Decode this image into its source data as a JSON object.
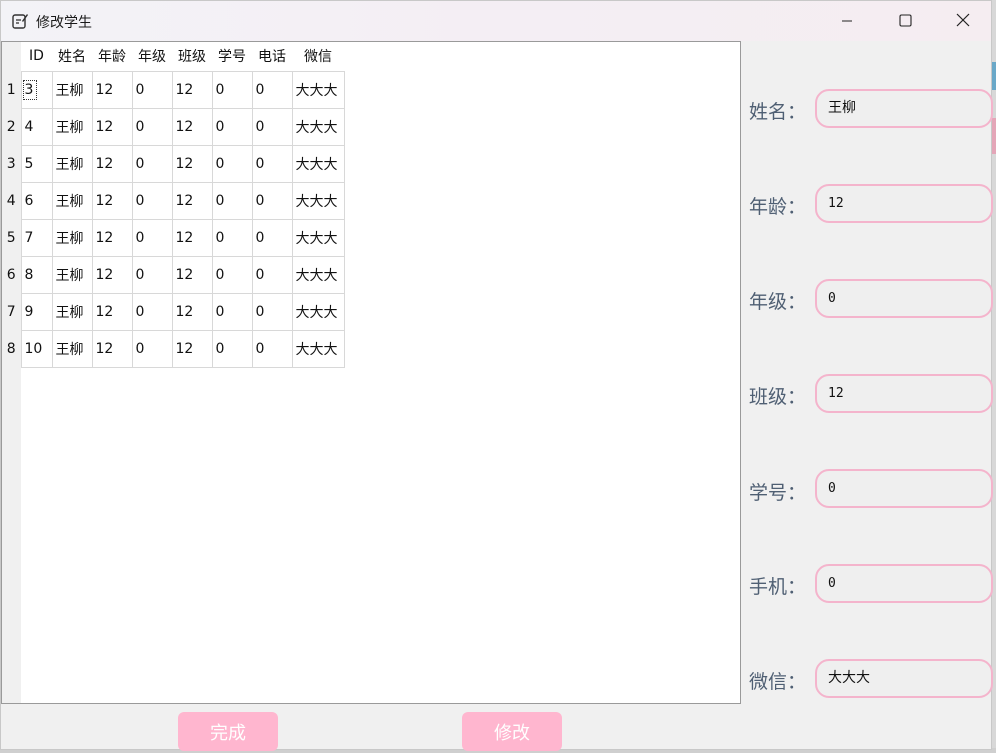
{
  "window": {
    "title": "修改学生"
  },
  "table": {
    "columns": [
      "ID",
      "姓名",
      "年龄",
      "年级",
      "班级",
      "学号",
      "电话",
      "微信"
    ],
    "rows": [
      {
        "num": "1",
        "cells": [
          "3",
          "王柳",
          "12",
          "0",
          "12",
          "0",
          "0",
          "大大大"
        ]
      },
      {
        "num": "2",
        "cells": [
          "4",
          "王柳",
          "12",
          "0",
          "12",
          "0",
          "0",
          "大大大"
        ]
      },
      {
        "num": "3",
        "cells": [
          "5",
          "王柳",
          "12",
          "0",
          "12",
          "0",
          "0",
          "大大大"
        ]
      },
      {
        "num": "4",
        "cells": [
          "6",
          "王柳",
          "12",
          "0",
          "12",
          "0",
          "0",
          "大大大"
        ]
      },
      {
        "num": "5",
        "cells": [
          "7",
          "王柳",
          "12",
          "0",
          "12",
          "0",
          "0",
          "大大大"
        ]
      },
      {
        "num": "6",
        "cells": [
          "8",
          "王柳",
          "12",
          "0",
          "12",
          "0",
          "0",
          "大大大"
        ]
      },
      {
        "num": "7",
        "cells": [
          "9",
          "王柳",
          "12",
          "0",
          "12",
          "0",
          "0",
          "大大大"
        ]
      },
      {
        "num": "8",
        "cells": [
          "10",
          "王柳",
          "12",
          "0",
          "12",
          "0",
          "0",
          "大大大"
        ]
      }
    ]
  },
  "form": {
    "name_label": "姓名：",
    "name_value": "王柳",
    "age_label": "年龄：",
    "age_value": "12",
    "grade_label": "年级：",
    "grade_value": "0",
    "class_label": "班级：",
    "class_value": "12",
    "student_no_label": "学号：",
    "student_no_value": "0",
    "phone_label": "手机：",
    "phone_value": "0",
    "wechat_label": "微信：",
    "wechat_value": "大大大"
  },
  "buttons": {
    "done_label": "完成",
    "edit_label": "修改"
  },
  "colors": {
    "accent_pink": "#ffb6cf",
    "input_border": "#f4b4cc",
    "label_text": "#4f5f73"
  },
  "icons": {
    "app": "edit-note-icon",
    "minimize": "minimize-icon",
    "maximize": "maximize-icon",
    "close": "close-icon"
  }
}
